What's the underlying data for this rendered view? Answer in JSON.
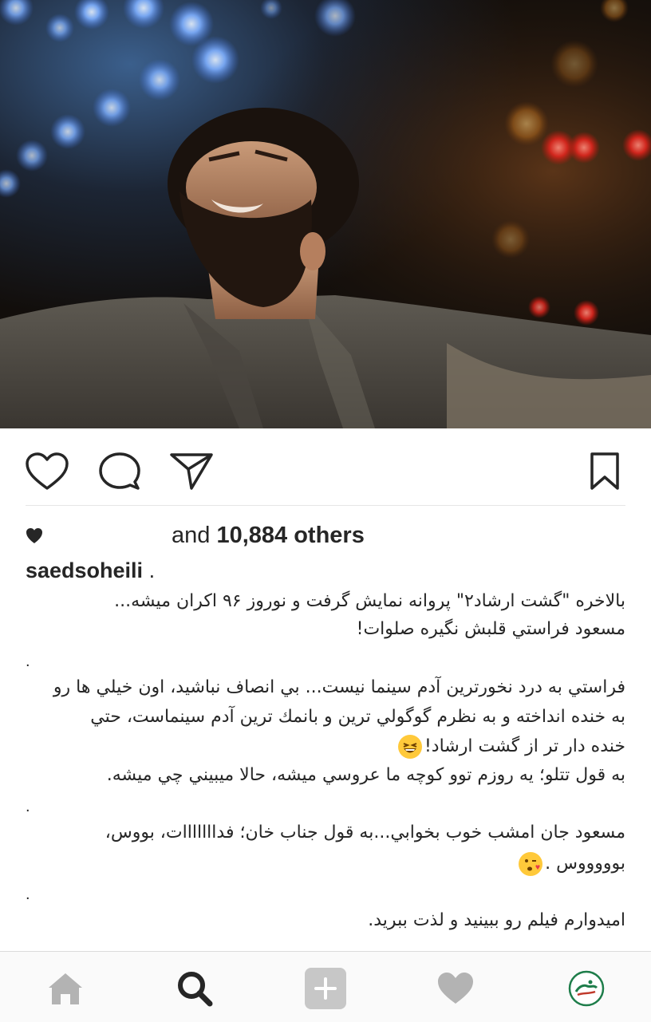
{
  "post": {
    "likes": {
      "prefix": "and",
      "count": "10,884",
      "suffix": "others"
    },
    "username": "saedsoheili",
    "username_dot": ".",
    "caption": {
      "line1": "بالاخره \"گشت ارشاد۲\" پروانه نمایش گرفت و نوروز ۹۶ اکران میشه...",
      "line2": "مسعود فراستي قلبش نگيره صلوات!",
      "dot1": ".",
      "line3": "فراستي به درد نخورترين آدم سينما نيست... بي انصاف نباشيد، اون خيلي ها رو",
      "line4": "به خنده انداخته و به نظرم گوگولي ترين و بانمك ترين آدم سينماست، حتي",
      "line5": "خنده دار تر از گشت ارشاد!",
      "line6": "به قول تتلو؛ يه روزم توو کوچه ما عروسي ميشه، حالا ميبيني چي ميشه.",
      "dot2": ".",
      "line7": "مسعود جان امشب خوب بخوابي...به قول جناب خان؛ فدااااااات، بووس،",
      "line8": "بوووووس .",
      "dot3": ".",
      "line9": "اميدوارم فيلم رو ببينيد و لذت ببريد."
    }
  },
  "icons": {
    "like": "heart-outline-icon",
    "comment": "comment-bubble-icon",
    "share": "send-paper-plane-icon",
    "save": "bookmark-icon"
  },
  "nav": [
    "home-icon",
    "search-icon",
    "add-post-icon",
    "activity-heart-icon",
    "profile-avatar"
  ],
  "colors": {
    "text": "#262626",
    "icon": "#262626",
    "nav_inactive": "#b3b3b3",
    "nav_active": "#262626",
    "emoji": "#ffc93a",
    "avatar_accent": "#1e7d4a"
  }
}
